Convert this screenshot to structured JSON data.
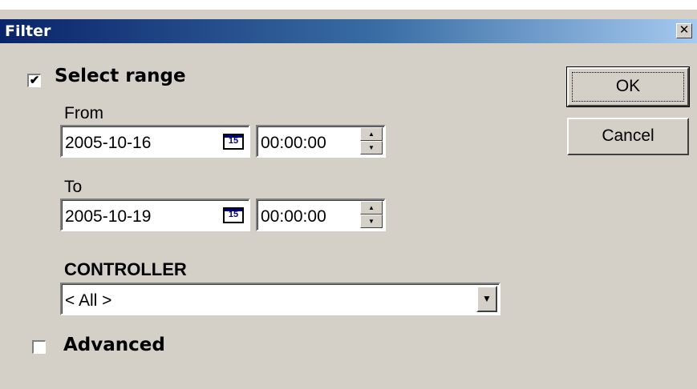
{
  "window": {
    "title": "Filter",
    "close_glyph": "✕"
  },
  "select_range": {
    "label": "Select range",
    "checked": true,
    "check_glyph": "✔"
  },
  "from": {
    "label": "From",
    "date": "2005-10-16",
    "time": "00:00:00",
    "calendar_icon_text": "15"
  },
  "to": {
    "label": "To",
    "date": "2005-10-19",
    "time": "00:00:00",
    "calendar_icon_text": "15"
  },
  "controller": {
    "label": "CONTROLLER",
    "selected": "< All >"
  },
  "advanced": {
    "label": "Advanced",
    "checked": false
  },
  "buttons": {
    "ok": "OK",
    "cancel": "Cancel"
  },
  "icons": {
    "spin_up": "▲",
    "spin_down": "▼",
    "dropdown": "▼"
  }
}
